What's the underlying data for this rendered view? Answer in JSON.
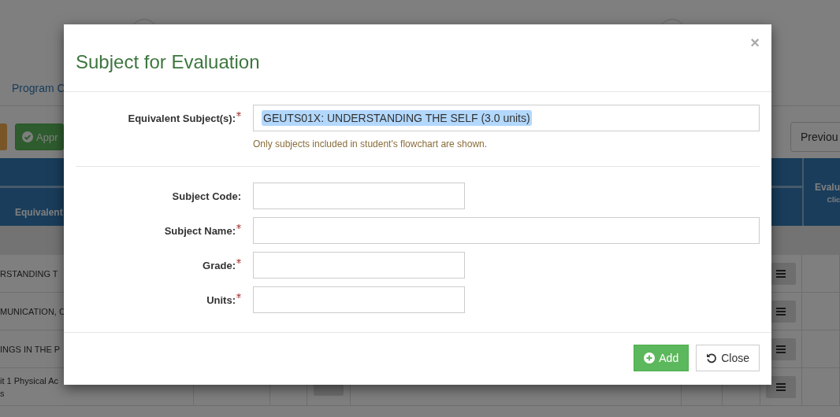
{
  "page": {
    "steps": [
      {
        "done": false
      },
      {
        "done": false
      }
    ],
    "link": "Program C",
    "toolbar": [
      {
        "kind": "warning"
      },
      {
        "kind": "success",
        "label": "Appr"
      }
    ],
    "pager": {
      "label": "Previou"
    },
    "table": {
      "columns": [
        "Equivalent",
        "Evalu"
      ],
      "column_hint": "Clic",
      "rows": [
        {
          "lines": [
            "RSTANDING T"
          ],
          "extra_button": false
        },
        {
          "lines": [
            "MUNICATION, C"
          ],
          "extra_button": false
        },
        {
          "lines": [
            "INGS IN THE P"
          ],
          "extra_button": false
        },
        {
          "lines": [
            "it 1 Physical Ac",
            "s"
          ],
          "extra_button": true
        }
      ]
    }
  },
  "modal": {
    "title": "Subject for Evaluation",
    "close_label": "×",
    "fields": [
      {
        "kind": "select",
        "label": "Equivalent Subject(s):",
        "required": true,
        "value": "GEUTS01X: UNDERSTANDING THE SELF (3.0 units)",
        "help": "Only subjects included in student's flowchart are shown."
      },
      {
        "kind": "text",
        "label": "Subject Code:",
        "required": false,
        "wide": false
      },
      {
        "kind": "text",
        "label": "Subject Name:",
        "required": true,
        "wide": true
      },
      {
        "kind": "text",
        "label": "Grade:",
        "required": true,
        "wide": false
      },
      {
        "kind": "text",
        "label": "Units:",
        "required": true,
        "wide": false
      }
    ],
    "buttons": [
      {
        "kind": "success",
        "label": "Add"
      },
      {
        "kind": "default",
        "label": "Close"
      }
    ]
  }
}
